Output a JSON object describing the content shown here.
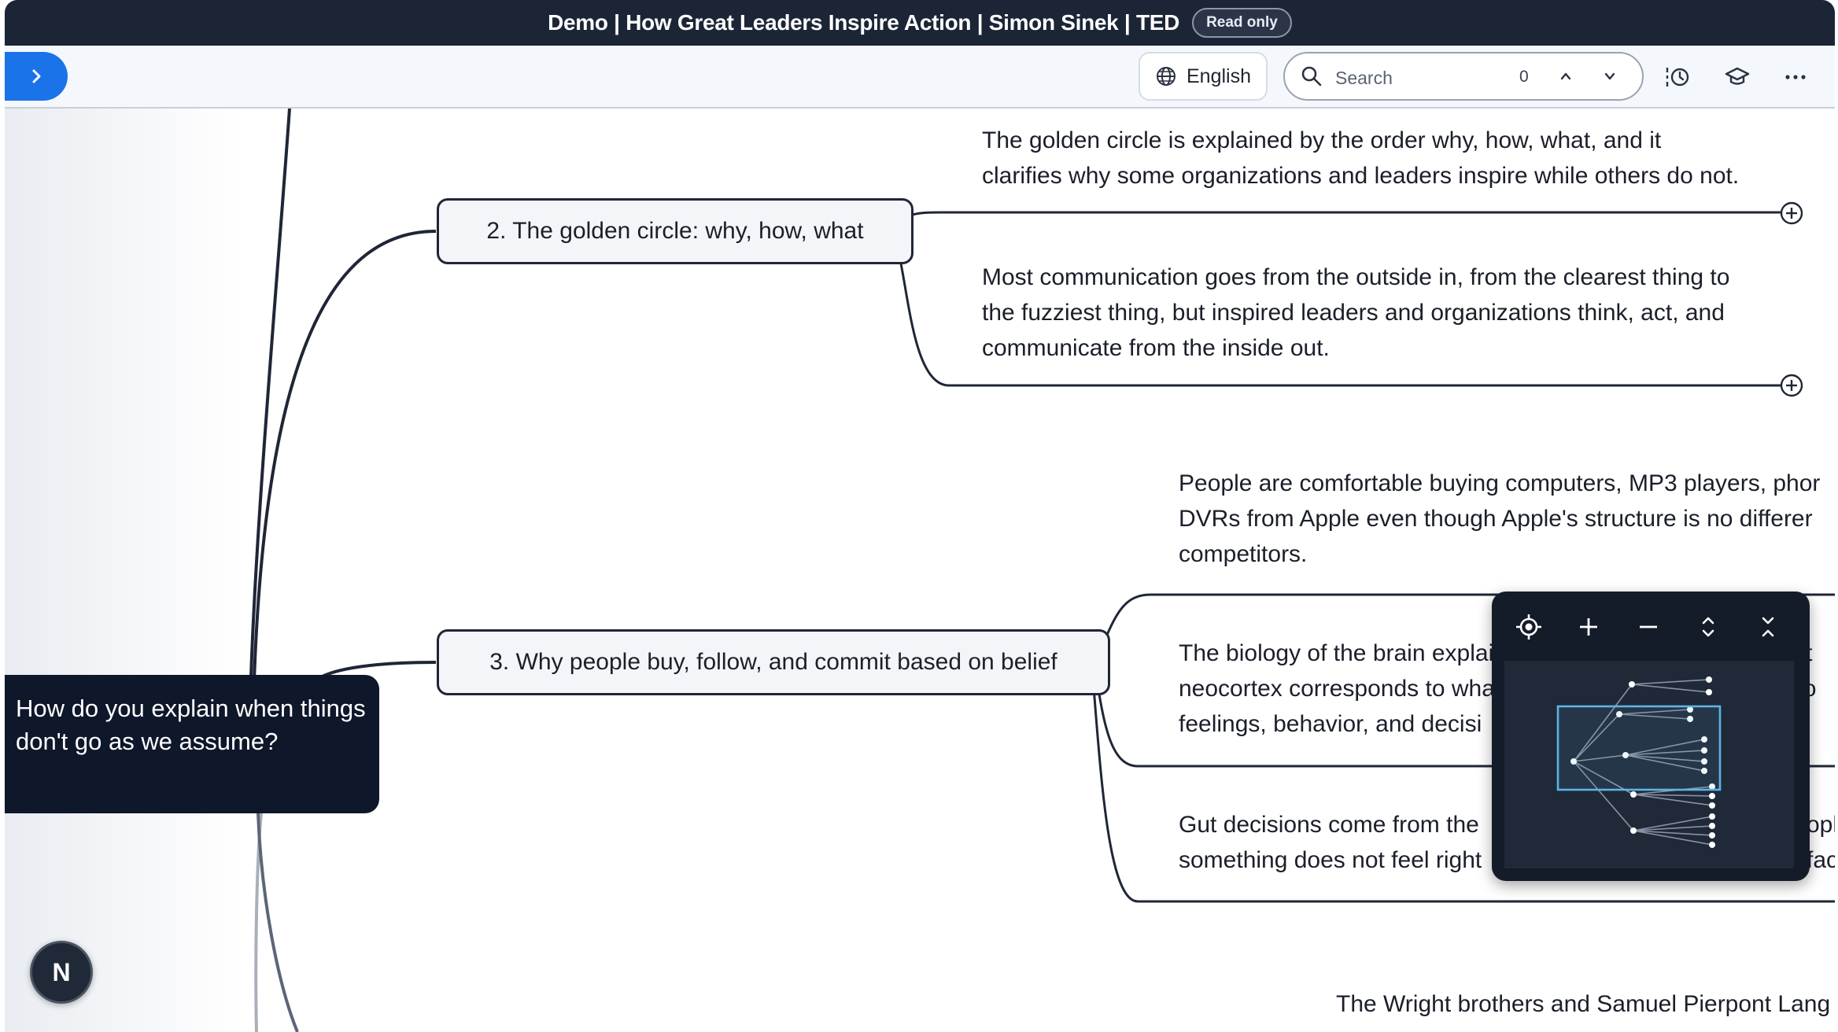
{
  "header": {
    "title": "Demo | How Great Leaders Inspire Action | Simon Sinek | TED",
    "badge": "Read only"
  },
  "toolbar": {
    "language": "English",
    "search_placeholder": "Search",
    "search_count": "0"
  },
  "mindmap": {
    "topic2": "2. The golden circle: why, how, what",
    "topic3": "3. Why people buy, follow, and commit based on belief",
    "note_golden": [
      "The golden circle is explained by the order why, how, what, and it",
      "clarifies why some organizations and leaders inspire while others do not."
    ],
    "note_communication": [
      "Most communication goes from the outside in, from the clearest thing to",
      "the fuzziest thing, but inspired leaders and organizations think, act, and",
      "communicate from the inside out."
    ],
    "note_apple": [
      "People are comfortable buying computers, MP3 players, phor",
      "DVRs from Apple even though Apple's structure is no differer",
      "competitors."
    ],
    "note_biology": [
      "The biology of the brain explains the golden circle, because t",
      "neocortex corresponds to what while the limbic brain is respo",
      "feelings, behavior, and decisi"
    ],
    "note_gut": [
      "Gut decisions come from the",
      "something does not feel right"
    ],
    "note_gut_cut": [
      "opl",
      "fac"
    ],
    "note_wright": "The Wright brothers and Samuel Pierpont Lang",
    "question": "How do you explain when things don't go as we assume?"
  },
  "avatar": {
    "initial": "N"
  },
  "icons": {
    "sidebar": "chevron-right-icon",
    "language": "globe-icon",
    "search": "search-icon",
    "prev": "chevron-up-icon",
    "next": "chevron-down-icon",
    "history": "history-icon",
    "learn": "graduation-cap-icon",
    "more": "more-icon"
  },
  "colors": {
    "accent": "#1a73e8",
    "dark": "#0f172a",
    "minimap_frame": "#5fb3e6"
  }
}
